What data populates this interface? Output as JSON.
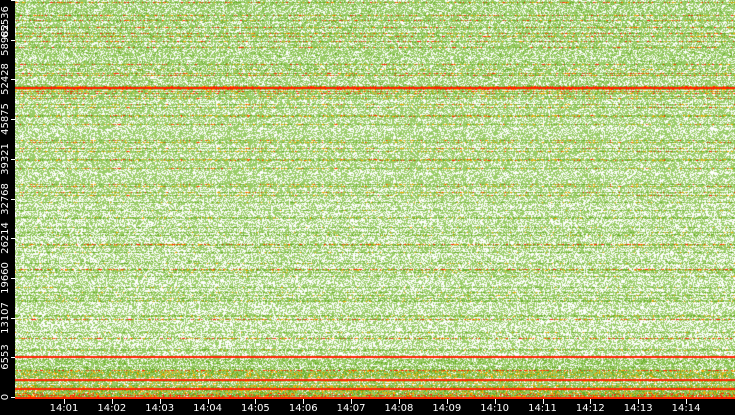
{
  "chart_data": {
    "type": "heatmap",
    "title": "",
    "xlabel": "",
    "ylabel": "",
    "x_ticks": [
      "14:01",
      "14:02",
      "14:03",
      "14:04",
      "14:05",
      "14:06",
      "14:07",
      "14:08",
      "14:09",
      "14:10",
      "14:11",
      "14:12",
      "14:13",
      "14:14"
    ],
    "x_range_minutes": [
      0.67,
      15.72
    ],
    "y_ticks": [
      "0",
      "6553",
      "13107",
      "19660",
      "26214",
      "32768",
      "39321",
      "45875",
      "52428",
      "58982",
      "65536"
    ],
    "y_range": [
      0,
      65536
    ],
    "colors": {
      "empty": "#ffffff",
      "low": "#99cc66",
      "medium": "#66aa22",
      "high": "#ffaa00",
      "very_high": "#ff2200"
    },
    "density_bands": [
      {
        "from": 0,
        "to": 800,
        "level": 0.95
      },
      {
        "from": 800,
        "to": 4500,
        "level": 0.85
      },
      {
        "from": 4500,
        "to": 6500,
        "level": 0.6
      },
      {
        "from": 6500,
        "to": 32768,
        "level": 0.25
      },
      {
        "from": 32768,
        "to": 50000,
        "level": 0.4
      },
      {
        "from": 50000,
        "to": 65536,
        "level": 0.5
      }
    ],
    "highlight_lines": [
      {
        "port": 6700,
        "color": "very_high"
      },
      {
        "port": 51200,
        "color": "very_high"
      },
      {
        "port": 1500,
        "color": "very_high"
      },
      {
        "port": 3000,
        "color": "very_high"
      }
    ]
  }
}
